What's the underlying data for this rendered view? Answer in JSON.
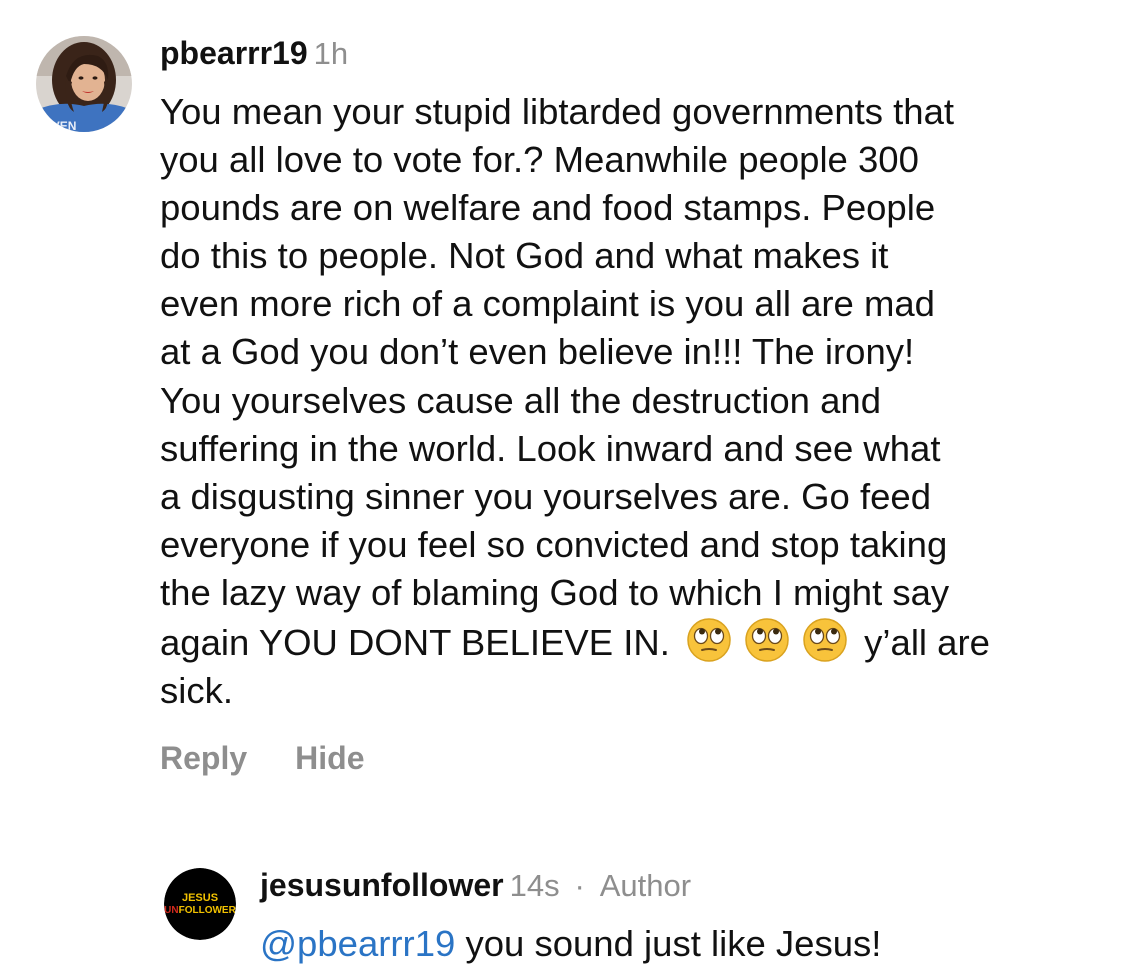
{
  "comment": {
    "username": "pbearrr19",
    "time": "1h",
    "lines": [
      "You mean your stupid libtarded governments that",
      "you all love to vote for.? Meanwhile people 300",
      "pounds are on welfare and food stamps. People",
      "do this to people.  Not God and what makes it",
      "even more rich of a complaint is you  all are mad",
      "at a God you don’t even believe in!!! The irony!",
      "You yourselves cause all the destruction and",
      "suffering in the world. Look inward and see what",
      "a disgusting sinner you yourselves are. Go feed",
      "everyone if you feel so convicted and stop taking",
      "the lazy way of blaming God to which I might say"
    ],
    "line12_start": "again YOU DONT BELIEVE IN. ",
    "line12_end": " y’all are",
    "line13": "sick.",
    "emojis": [
      "eye-roll-emoji",
      "eye-roll-emoji",
      "eye-roll-emoji"
    ],
    "actions": {
      "reply": "Reply",
      "hide": "Hide"
    }
  },
  "reply": {
    "username": "jesusunfollower",
    "time": "14s",
    "separator": "·",
    "role": "Author",
    "mention": "@pbearrr19",
    "text": " you sound just like Jesus!",
    "avatar_logo": {
      "line1": "JESUS",
      "line2_prefix": "UN",
      "line2_suffix": "FOLLOWER"
    }
  },
  "colors": {
    "text": "#111111",
    "meta": "#8e8e8e",
    "mention": "#2a74c5",
    "logo_bg": "#000000",
    "logo_yellow": "#f2c200",
    "logo_red": "#d42a1e",
    "emoji_face": "#f8c33b"
  }
}
